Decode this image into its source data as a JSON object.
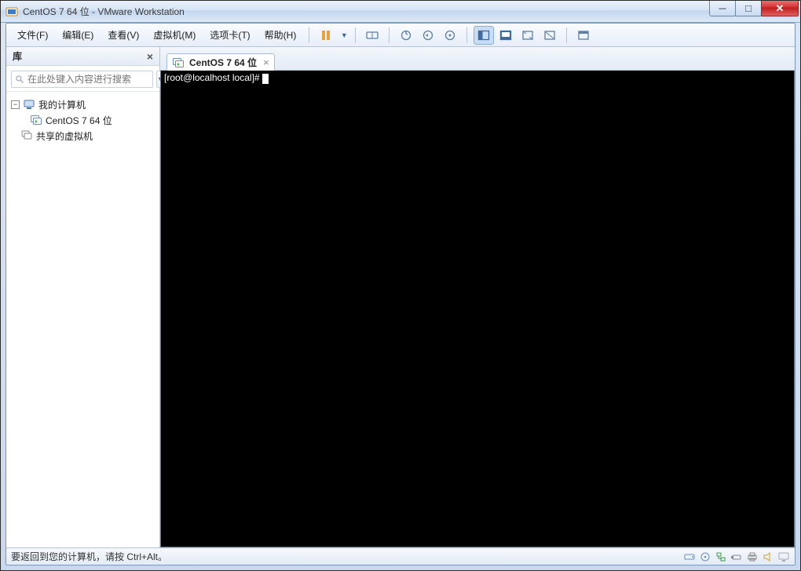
{
  "title": "CentOS 7 64 位 - VMware Workstation",
  "menu": {
    "file": "文件(F)",
    "edit": "编辑(E)",
    "view": "查看(V)",
    "vm": "虚拟机(M)",
    "tabs": "选项卡(T)",
    "help": "帮助(H)"
  },
  "sidebar": {
    "header": "库",
    "search_placeholder": "在此处键入内容进行搜索",
    "tree": {
      "root": "我的计算机",
      "vm1": "CentOS 7 64 位",
      "shared": "共享的虚拟机"
    }
  },
  "tab": {
    "label": "CentOS 7 64 位"
  },
  "terminal": {
    "prompt": "[root@localhost local]# "
  },
  "status": {
    "hint": "要返回到您的计算机，请按 Ctrl+Alt。"
  }
}
